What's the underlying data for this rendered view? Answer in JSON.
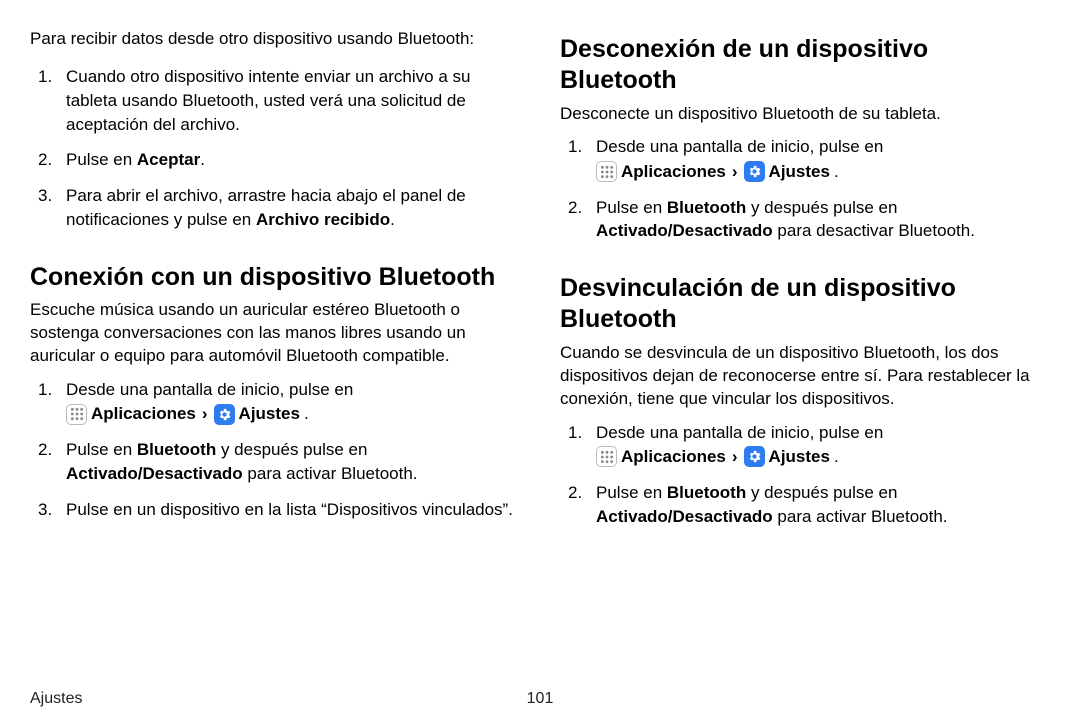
{
  "left": {
    "intro": "Para recibir datos desde otro dispositivo usando Bluetooth:",
    "steps_receive": [
      {
        "text": "Cuando otro dispositivo intente enviar un archivo a su tableta usando Bluetooth, usted verá una solicitud de aceptación del archivo."
      },
      {
        "pre": "Pulse en ",
        "strong": "Aceptar",
        "post": "."
      },
      {
        "pre": "Para abrir el archivo, arrastre hacia abajo el panel de notificaciones y pulse en ",
        "strong": "Archivo recibido",
        "post": "."
      }
    ],
    "h_connect": "Conexión con un dispositivo Bluetooth",
    "desc_connect": "Escuche música usando un auricular estéreo Bluetooth o sostenga conversaciones con las manos libres usando un auricular o equipo para automóvil Bluetooth compatible.",
    "steps_connect": [
      {
        "nav": true,
        "lead": "Desde una pantalla de inicio, pulse en"
      },
      {
        "pre": "Pulse en ",
        "b1": "Bluetooth",
        "mid": " y después pulse en ",
        "b2": "Activado/Desactivado",
        "post": " para activar Bluetooth."
      },
      {
        "text": "Pulse en un dispositivo en la lista “Dispositivos vinculados”."
      }
    ]
  },
  "right": {
    "h_disconnect": "Desconexión de un dispositivo Bluetooth",
    "desc_disconnect": "Desconecte un dispositivo Bluetooth de su tableta.",
    "steps_disconnect": [
      {
        "nav": true,
        "lead": "Desde una pantalla de inicio, pulse en"
      },
      {
        "pre": "Pulse en ",
        "b1": "Bluetooth",
        "mid": " y después pulse en ",
        "b2": "Activado/Desactivado",
        "post": " para desactivar Bluetooth."
      }
    ],
    "h_unpair": "Desvinculación de un dispositivo Bluetooth",
    "desc_unpair": "Cuando se desvincula de un dispositivo Bluetooth, los dos dispositivos dejan de reconocerse entre sí. Para restablecer la conexión, tiene que vincular los dispositivos.",
    "steps_unpair": [
      {
        "nav": true,
        "lead": "Desde una pantalla de inicio, pulse en"
      },
      {
        "pre": "Pulse en ",
        "b1": "Bluetooth",
        "mid": " y después pulse en ",
        "b2": "Activado/Desactivado",
        "post": " para activar Bluetooth."
      }
    ]
  },
  "nav": {
    "apps": "Aplicaciones",
    "sep": " › ",
    "settings": "Ajustes"
  },
  "footer": {
    "section": "Ajustes",
    "page": "101"
  }
}
